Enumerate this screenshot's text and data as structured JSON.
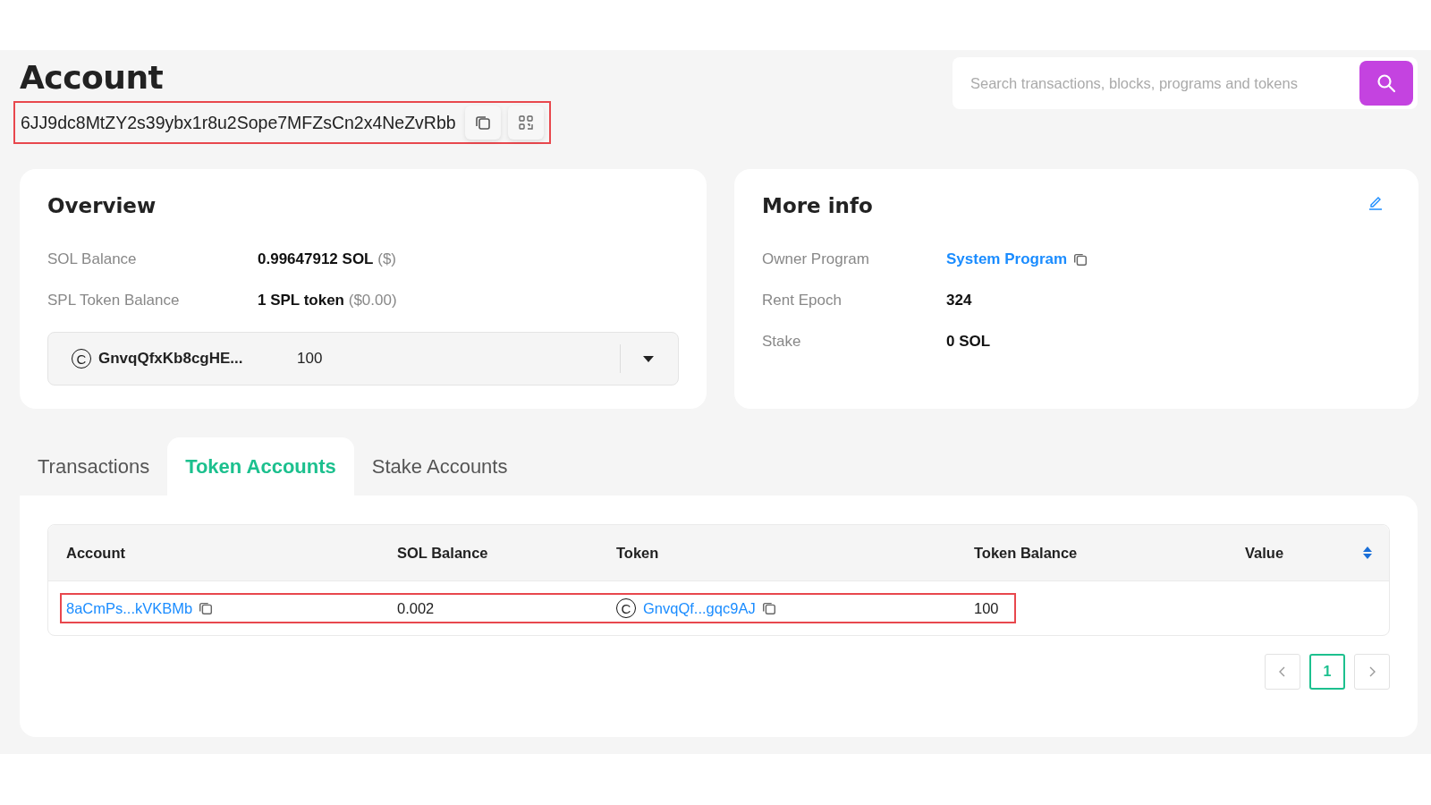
{
  "page": {
    "title": "Account",
    "address": "6JJ9dc8MtZY2s39ybx1r8u2Sope7MFZsCn2x4NeZvRbb",
    "address_highlighted": true
  },
  "search": {
    "placeholder": "Search transactions, blocks, programs and tokens"
  },
  "overview": {
    "title": "Overview",
    "rows": [
      {
        "label": "SOL Balance",
        "value": "0.99647912 SOL",
        "note": "($)"
      },
      {
        "label": "SPL Token Balance",
        "value": "1 SPL token",
        "note": "($0.00)"
      }
    ],
    "token_select": {
      "symbol": "C",
      "name": "GnvqQfxKb8cgHE...",
      "amount": "100"
    }
  },
  "more_info": {
    "title": "More info",
    "rows": [
      {
        "label": "Owner Program",
        "value": "System Program",
        "kind": "link"
      },
      {
        "label": "Rent Epoch",
        "value": "324",
        "kind": "text"
      },
      {
        "label": "Stake",
        "value": "0 SOL",
        "kind": "text"
      }
    ]
  },
  "tabs": [
    {
      "label": "Transactions",
      "selected": false
    },
    {
      "label": "Token Accounts",
      "selected": true
    },
    {
      "label": "Stake Accounts",
      "selected": false
    }
  ],
  "table": {
    "columns": [
      "Account",
      "SOL Balance",
      "Token",
      "Token Balance",
      "Value"
    ],
    "rows": [
      {
        "account": "8aCmPs...kVKBMb",
        "sol_balance": "0.002",
        "token_symbol": "C",
        "token": "GnvqQf...gqc9AJ",
        "token_balance": "100",
        "highlighted": true
      }
    ]
  },
  "pagination": {
    "pages": [
      {
        "label": "1",
        "selected": true
      }
    ]
  }
}
